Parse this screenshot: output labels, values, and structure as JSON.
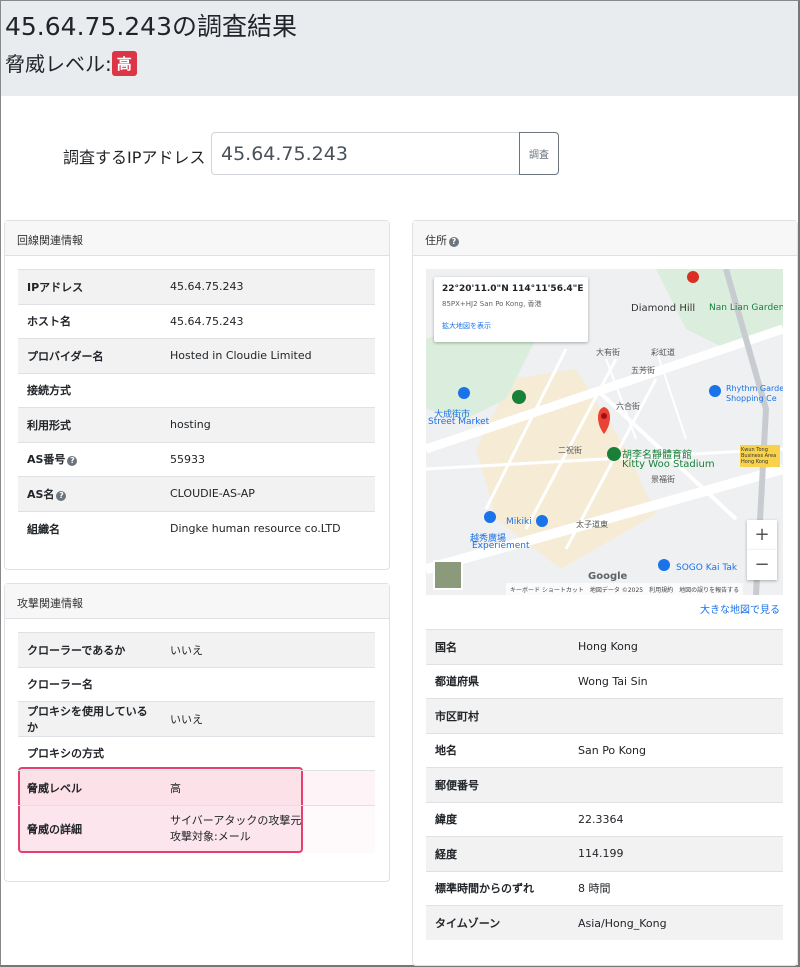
{
  "header": {
    "title": "45.64.75.243の調査結果",
    "threat_label": "脅威レベル:",
    "threat_badge": "高"
  },
  "search": {
    "label": "調査するIPアドレス",
    "value": "45.64.75.243",
    "button": "調査"
  },
  "line_card": {
    "title": "回線関連情報",
    "rows": [
      {
        "k": "IPアドレス",
        "v": "45.64.75.243"
      },
      {
        "k": "ホスト名",
        "v": "45.64.75.243"
      },
      {
        "k": "プロバイダー名",
        "v": "Hosted in Cloudie Limited"
      },
      {
        "k": "接続方式",
        "v": ""
      },
      {
        "k": "利用形式",
        "v": "hosting"
      },
      {
        "k": "AS番号",
        "v": "55933"
      },
      {
        "k": "AS名",
        "v": "CLOUDIE-AS-AP"
      },
      {
        "k": "組織名",
        "v": "Dingke human resource co.LTD"
      }
    ]
  },
  "attack_card": {
    "title": "攻撃関連情報",
    "rows": [
      {
        "k": "クローラーであるか",
        "v": "いいえ"
      },
      {
        "k": "クローラー名",
        "v": ""
      },
      {
        "k": "プロキシを使用しているか",
        "v": "いいえ"
      },
      {
        "k": "プロキシの方式",
        "v": ""
      },
      {
        "k": "脅威レベル",
        "v": "高"
      },
      {
        "k": "脅威の詳細",
        "v": "サイバーアタックの攻撃元",
        "v2": "攻撃対象:メール"
      }
    ]
  },
  "address_card": {
    "title": "住所",
    "map": {
      "coord": "22°20'11.0\"N 114°11'56.4\"E",
      "place": "85PX+HJ2 San Po Kong, 香港",
      "link": "拡大地図を表示",
      "footer": "キーボード ショートカット　地図データ ©2025　利用規約　地図の誤りを報告する",
      "labels": [
        "Diamond Hill",
        "Nan Lian Garden",
        "大成街市",
        "Street Market",
        "胡李名靜體育館",
        "Kitty Woo Stadium",
        "越秀廣場",
        "Experiement",
        "Mikiki",
        "SOGO Kai Tak",
        "Rhythm Garden",
        "Shopping Ce",
        "Kwun Tong Business Area Hong Kong",
        "Google",
        "彩虹道",
        "太子道東",
        "大有街",
        "五芳街",
        "六合街",
        "二祝街",
        "景福街"
      ]
    },
    "big_map_link": "大きな地図で見る",
    "rows": [
      {
        "k": "国名",
        "v": "Hong Kong"
      },
      {
        "k": "都道府県",
        "v": "Wong Tai Sin"
      },
      {
        "k": "市区町村",
        "v": ""
      },
      {
        "k": "地名",
        "v": "San Po Kong"
      },
      {
        "k": "郵便番号",
        "v": ""
      },
      {
        "k": "緯度",
        "v": "22.3364"
      },
      {
        "k": "経度",
        "v": "114.199"
      },
      {
        "k": "標準時間からのずれ",
        "v": "8 時間"
      },
      {
        "k": "タイムゾーン",
        "v": "Asia/Hong_Kong"
      }
    ]
  },
  "colors": {
    "badge": "#dc3545",
    "highlight": "#e83e70",
    "link": "#1a73e8"
  }
}
